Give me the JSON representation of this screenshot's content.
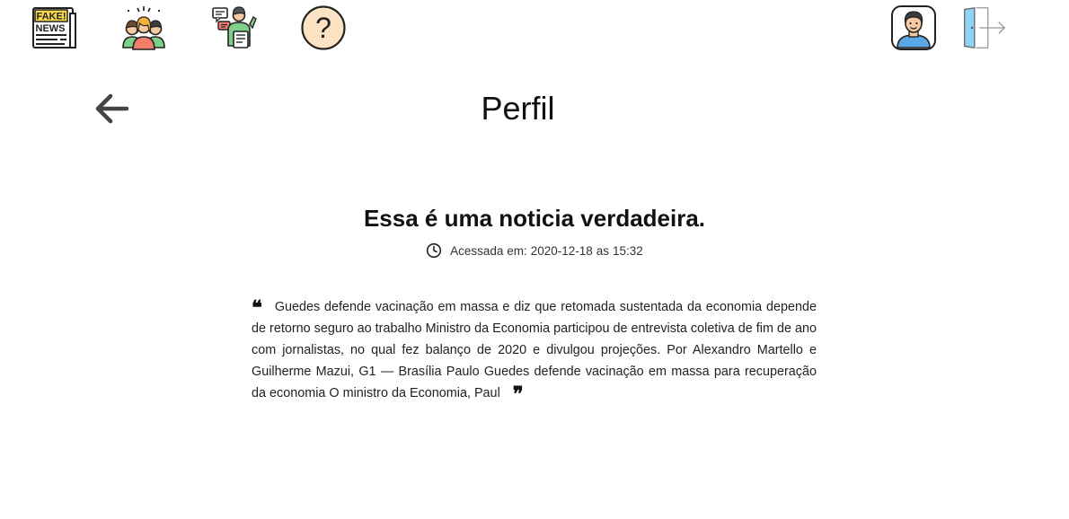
{
  "nav": {
    "items": [
      {
        "id": "fake-news",
        "icon": "fake-news-newspaper-icon",
        "badge_top": "FAKE!",
        "badge_bottom": "NEWS"
      },
      {
        "id": "community",
        "icon": "community-people-icon"
      },
      {
        "id": "report",
        "icon": "reporter-icon"
      },
      {
        "id": "help",
        "icon": "question-mark-icon",
        "glyph": "?"
      },
      {
        "id": "profile",
        "icon": "user-avatar-icon"
      },
      {
        "id": "logout",
        "icon": "logout-door-icon"
      }
    ]
  },
  "header": {
    "back_icon": "arrow-left-icon",
    "title": "Perfil"
  },
  "result": {
    "heading": "Essa é uma noticia verdadeira.",
    "access_icon": "clock-icon",
    "access_label": "Acessada em:",
    "access_date": "2020-12-18",
    "access_sep": "as",
    "access_time": "15:32"
  },
  "article": {
    "open_quote": "❝",
    "close_quote": "❞",
    "text": "Guedes defende vacinação em massa e diz que retomada sustentada da economia depende de retorno seguro ao trabalho Ministro da Economia participou de entrevista coletiva de fim de ano com jornalistas, no qual fez balanço de 2020 e divulgou projeções. Por Alexandro Martello e Guilherme Mazui, G1 — Brasília Paulo Guedes defende vacinação em massa para recuperação da economia O ministro da Economia, Paul"
  },
  "colors": {
    "text": "#222222",
    "newspaper_yellow": "#f9d84a",
    "shirt_blue": "#5aa9e6",
    "door_blue": "#8fd3f5",
    "help_bg": "#fde2c4"
  }
}
